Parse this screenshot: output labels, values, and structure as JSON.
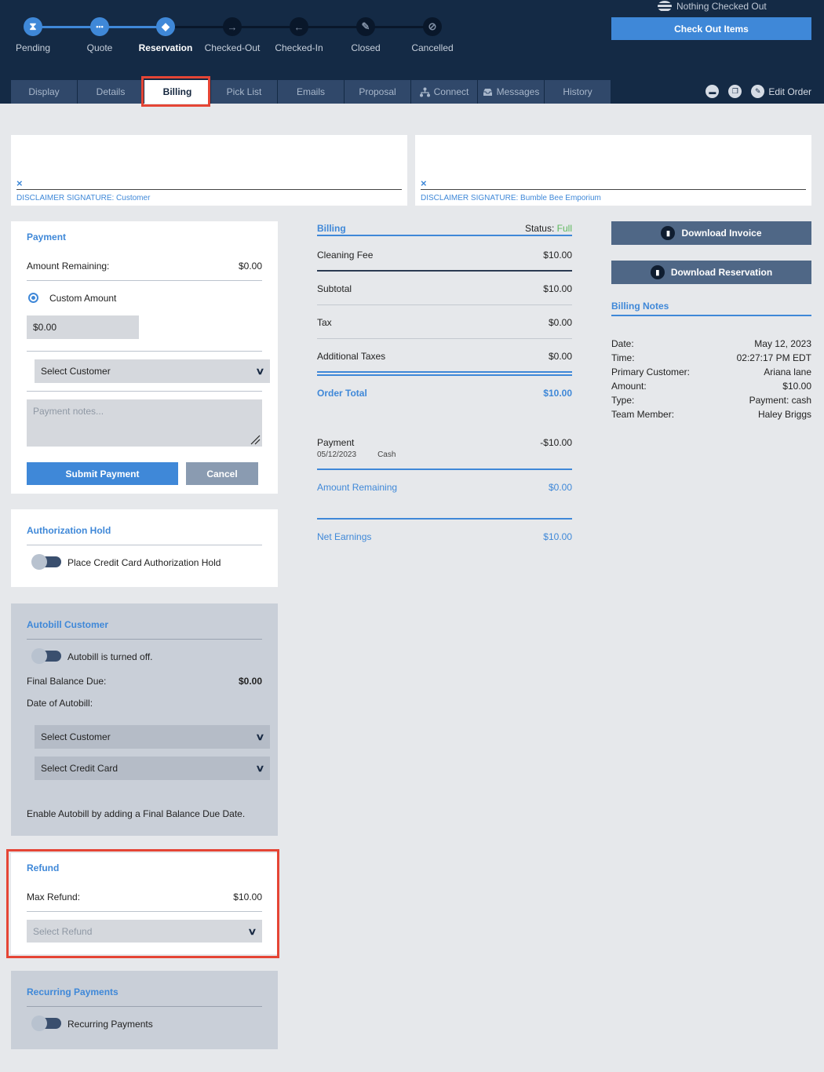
{
  "steps": [
    {
      "label": "Pending",
      "icon": "hourglass-icon",
      "glyph": "⧗",
      "state": "done"
    },
    {
      "label": "Quote",
      "icon": "quote-icon",
      "glyph": "•••",
      "state": "done"
    },
    {
      "label": "Reservation",
      "icon": "tag-icon",
      "glyph": "◆",
      "state": "current"
    },
    {
      "label": "Checked-Out",
      "icon": "arrow-right-icon",
      "glyph": "→",
      "state": "todo"
    },
    {
      "label": "Checked-In",
      "icon": "arrow-left-icon",
      "glyph": "←",
      "state": "todo"
    },
    {
      "label": "Closed",
      "icon": "gavel-icon",
      "glyph": "✎",
      "state": "todo"
    },
    {
      "label": "Cancelled",
      "icon": "cancel-icon",
      "glyph": "⊘",
      "state": "todo"
    }
  ],
  "checkout_status": "Nothing Checked Out",
  "checkout_button": "Check Out Items",
  "tabs": [
    {
      "label": "Display",
      "icon": ""
    },
    {
      "label": "Details",
      "icon": ""
    },
    {
      "label": "Billing",
      "icon": ""
    },
    {
      "label": "Pick List",
      "icon": ""
    },
    {
      "label": "Emails",
      "icon": ""
    },
    {
      "label": "Proposal",
      "icon": ""
    },
    {
      "label": "Connect",
      "icon": "connect-icon"
    },
    {
      "label": "Messages",
      "icon": "inbox-icon"
    },
    {
      "label": "History",
      "icon": ""
    }
  ],
  "edit_order": "Edit Order",
  "signatures": {
    "x_mark": "×",
    "customer": "DISCLAIMER SIGNATURE: Customer",
    "company": "DISCLAIMER SIGNATURE: Bumble Bee Emporium"
  },
  "payment": {
    "title": "Payment",
    "amount_remaining_label": "Amount Remaining:",
    "amount_remaining": "$0.00",
    "custom_amount_label": "Custom Amount",
    "amount_value": "$0.00",
    "select_customer": "Select Customer",
    "notes_placeholder": "Payment notes...",
    "submit": "Submit Payment",
    "cancel": "Cancel"
  },
  "auth_hold": {
    "title": "Authorization Hold",
    "toggle_label": "Place Credit Card Authorization Hold"
  },
  "autobill": {
    "title": "Autobill Customer",
    "toggle_label": "Autobill is turned off.",
    "final_balance_label": "Final Balance Due:",
    "final_balance": "$0.00",
    "date_label": "Date of Autobill:",
    "select_customer": "Select Customer",
    "select_card": "Select Credit Card",
    "hint": "Enable Autobill by adding a Final Balance Due Date."
  },
  "refund": {
    "title": "Refund",
    "max_label": "Max Refund:",
    "max_value": "$10.00",
    "select_placeholder": "Select Refund"
  },
  "recurring": {
    "title": "Recurring Payments",
    "toggle_label": "Recurring Payments"
  },
  "billing": {
    "title": "Billing",
    "status_label": "Status:",
    "status_value": "Full",
    "status_color": "#5cb85c",
    "cleaning_fee_label": "Cleaning Fee",
    "cleaning_fee": "$10.00",
    "subtotal_label": "Subtotal",
    "subtotal": "$10.00",
    "tax_label": "Tax",
    "tax": "$0.00",
    "additional_taxes_label": "Additional Taxes",
    "additional_taxes": "$0.00",
    "order_total_label": "Order Total",
    "order_total": "$10.00",
    "payment_label": "Payment",
    "payment_amount": "-$10.00",
    "payment_date": "05/12/2023",
    "payment_method": "Cash",
    "amount_remaining_label": "Amount Remaining",
    "amount_remaining": "$0.00",
    "net_earnings_label": "Net Earnings",
    "net_earnings": "$10.00"
  },
  "downloads": {
    "invoice": "Download Invoice",
    "reservation": "Download Reservation"
  },
  "billing_notes": {
    "title": "Billing Notes",
    "rows": [
      {
        "label": "Date:",
        "value": "May 12, 2023"
      },
      {
        "label": "Time:",
        "value": "02:27:17 PM EDT"
      },
      {
        "label": "Primary Customer:",
        "value": "Ariana lane"
      },
      {
        "label": "Amount:",
        "value": "$10.00"
      },
      {
        "label": "Type:",
        "value": "Payment: cash"
      },
      {
        "label": "Team Member:",
        "value": "Haley Briggs"
      }
    ]
  },
  "colors": {
    "accent": "#3f88d8",
    "header": "#142a45",
    "highlight": "#e54535"
  }
}
